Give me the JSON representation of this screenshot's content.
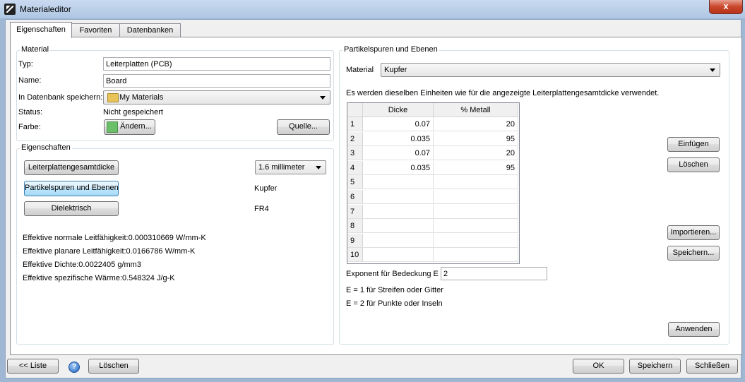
{
  "window": {
    "title": "Materialeditor",
    "close_glyph": "x"
  },
  "tabs": [
    {
      "label": "Eigenschaften",
      "active": true
    },
    {
      "label": "Favoriten",
      "active": false
    },
    {
      "label": "Datenbanken",
      "active": false
    }
  ],
  "material_group": {
    "title": "Material",
    "typ_label": "Typ:",
    "typ_value": "Leiterplatten (PCB)",
    "name_label": "Name:",
    "name_value": "Board",
    "db_label": "In Datenbank speichern:",
    "db_value": "My Materials",
    "status_label": "Status:",
    "status_value": "Nicht gespeichert",
    "farbe_label": "Farbe:",
    "aendern_label": "Ändern...",
    "quelle_label": "Quelle...",
    "swatch_color": "#6abf69"
  },
  "properties_group": {
    "title": "Eigenschaften",
    "btn_thickness": "Leiterplattengesamtdicke",
    "thickness_value": "1.6 millimeter",
    "btn_traces": "Partikelspuren und Ebenen",
    "traces_value": "Kupfer",
    "btn_dielectric": "Dielektrisch",
    "dielectric_value": "FR4",
    "effective": [
      "Effektive normale Leitfähigkeit:0.000310669 W/mm-K",
      "Effektive planare Leitfähigkeit:0.0166786 W/mm-K",
      "Effektive Dichte:0.0022405 g/mm3",
      "Effektive spezifische Wärme:0.548324 J/g-K"
    ]
  },
  "traces_group": {
    "title": "Partikelspuren und Ebenen",
    "material_label": "Material",
    "material_value": "Kupfer",
    "info_text": "Es werden dieselben Einheiten wie für die angezeigte Leiterplattengesamtdicke verwendet.",
    "columns": [
      "Dicke",
      "% Metall"
    ],
    "rows": [
      {
        "n": "1",
        "dicke": "0.07",
        "metall": "20"
      },
      {
        "n": "2",
        "dicke": "0.035",
        "metall": "95"
      },
      {
        "n": "3",
        "dicke": "0.07",
        "metall": "20"
      },
      {
        "n": "4",
        "dicke": "0.035",
        "metall": "95"
      },
      {
        "n": "5",
        "dicke": "",
        "metall": ""
      },
      {
        "n": "6",
        "dicke": "",
        "metall": ""
      },
      {
        "n": "7",
        "dicke": "",
        "metall": ""
      },
      {
        "n": "8",
        "dicke": "",
        "metall": ""
      },
      {
        "n": "9",
        "dicke": "",
        "metall": ""
      },
      {
        "n": "10",
        "dicke": "",
        "metall": ""
      }
    ],
    "btn_insert": "Einfügen",
    "btn_delete": "Löschen",
    "btn_import": "Importieren...",
    "btn_save": "Speichern...",
    "exponent_label": "Exponent für Bedeckung E",
    "exponent_value": "2",
    "note1": "E = 1 für Streifen oder Gitter",
    "note2": "E = 2 für Punkte oder Inseln",
    "btn_apply": "Anwenden"
  },
  "footer": {
    "btn_list": "<< Liste",
    "help_glyph": "?",
    "btn_delete": "Löschen",
    "btn_ok": "OK",
    "btn_save": "Speichern",
    "btn_close": "Schließen"
  }
}
